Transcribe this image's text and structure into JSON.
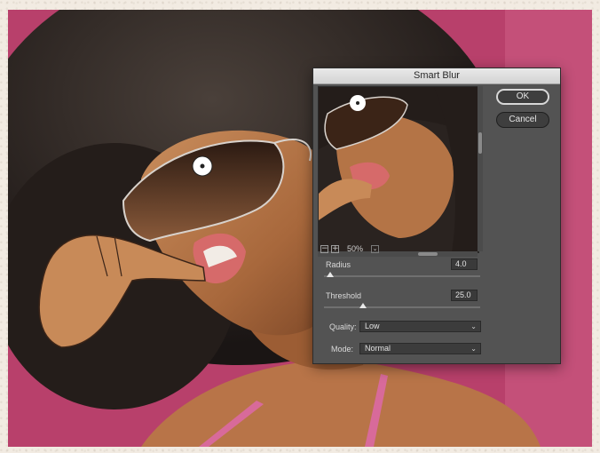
{
  "dialog": {
    "title": "Smart Blur",
    "ok_label": "OK",
    "cancel_label": "Cancel",
    "preview": {
      "zoom": "50%",
      "zoom_out_icon": "minus-square-icon",
      "zoom_in_icon": "plus-square-icon"
    },
    "radius": {
      "label": "Radius",
      "value": "4.0",
      "fraction": 0.04
    },
    "threshold": {
      "label": "Threshold",
      "value": "25.0",
      "fraction": 0.25
    },
    "quality": {
      "label": "Quality:",
      "value": "Low"
    },
    "mode": {
      "label": "Mode:",
      "value": "Normal"
    }
  },
  "colors": {
    "background_pink": "#b8406b",
    "dialog_bg": "#535353",
    "titlebar": "#dcdcdc"
  }
}
